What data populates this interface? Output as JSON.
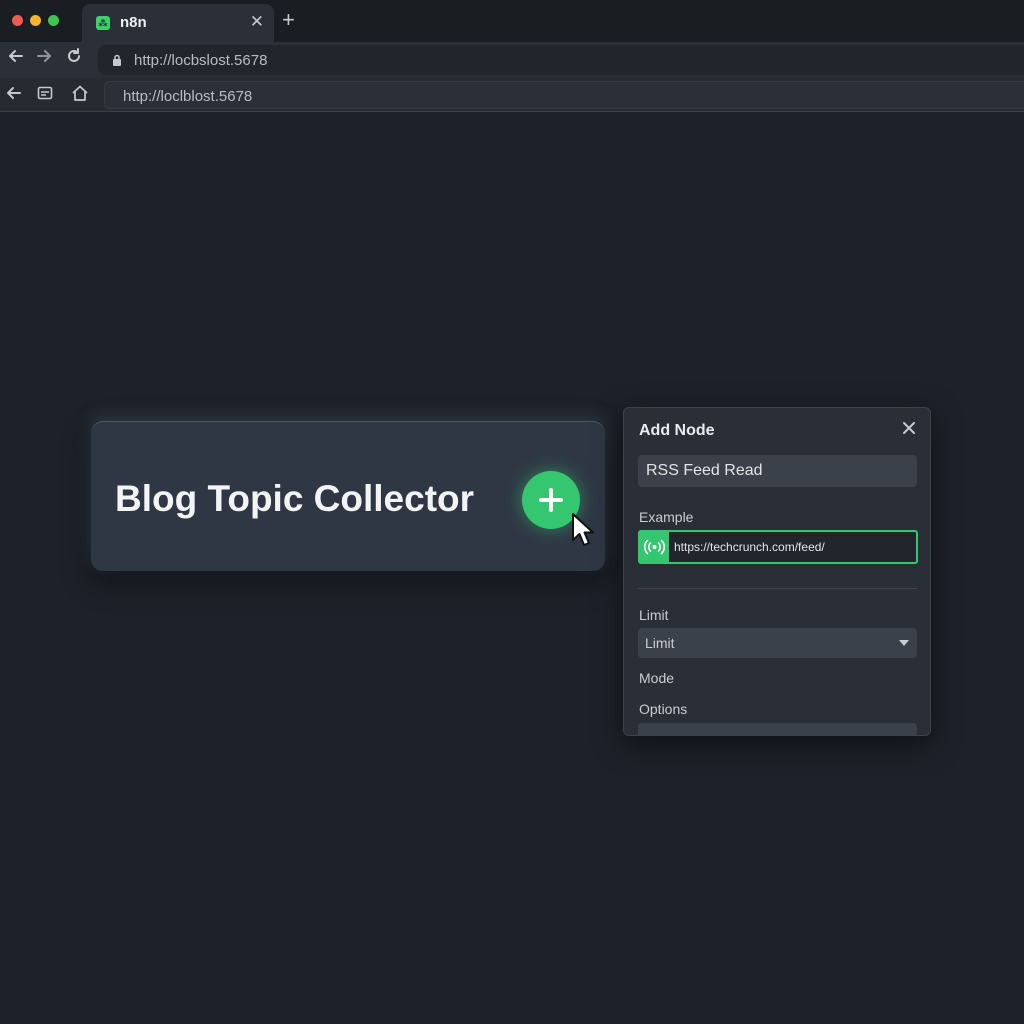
{
  "browser": {
    "tab_title": "n8n",
    "tab_favicon": "n8n-icon",
    "url_primary": "http://locbslost.5678",
    "url_secondary": "http://loclblost.5678"
  },
  "canvas": {
    "node": {
      "title": "Blog Topic Collector",
      "add_icon": "plus-icon"
    }
  },
  "panel": {
    "title": "Add Node",
    "search_value": "RSS Feed Read",
    "example_label": "Example",
    "example_value": "https://techcrunch.com/feed/",
    "limit_label": "Limit",
    "limit_select_value": "Limit",
    "mode_label": "Mode",
    "options_label": "Options"
  },
  "colors": {
    "accent": "#35c770",
    "background": "#1d2129",
    "panel": "#2a2f37"
  }
}
